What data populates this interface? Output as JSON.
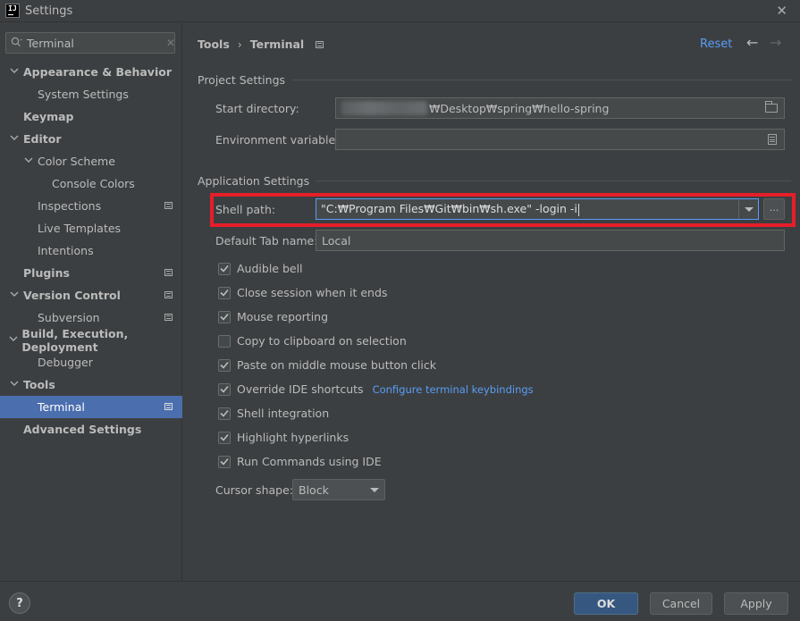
{
  "window": {
    "title": "Settings",
    "app_icon_text": "IJ"
  },
  "sidebar": {
    "search": {
      "value": "Terminal",
      "placeholder": ""
    },
    "items": [
      {
        "label": "Appearance & Behavior",
        "level": 0,
        "bold": true,
        "arrow": "expanded"
      },
      {
        "label": "System Settings",
        "level": 1
      },
      {
        "label": "Keymap",
        "level": 0,
        "bold": true
      },
      {
        "label": "Editor",
        "level": 0,
        "bold": true,
        "arrow": "expanded"
      },
      {
        "label": "Color Scheme",
        "level": 1,
        "arrow": "expanded"
      },
      {
        "label": "Console Colors",
        "level": 2
      },
      {
        "label": "Inspections",
        "level": 1,
        "project_icon": true
      },
      {
        "label": "Live Templates",
        "level": 1
      },
      {
        "label": "Intentions",
        "level": 1
      },
      {
        "label": "Plugins",
        "level": 0,
        "bold": true,
        "project_icon": true
      },
      {
        "label": "Version Control",
        "level": 0,
        "bold": true,
        "arrow": "expanded",
        "project_icon": true
      },
      {
        "label": "Subversion",
        "level": 1,
        "project_icon": true
      },
      {
        "label": "Build, Execution, Deployment",
        "level": 0,
        "bold": true,
        "arrow": "expanded"
      },
      {
        "label": "Debugger",
        "level": 1
      },
      {
        "label": "Tools",
        "level": 0,
        "bold": true,
        "arrow": "expanded"
      },
      {
        "label": "Terminal",
        "level": 1,
        "selected": true,
        "project_icon": true
      },
      {
        "label": "Advanced Settings",
        "level": 0,
        "bold": true
      }
    ]
  },
  "header": {
    "breadcrumb": [
      "Tools",
      "Terminal"
    ],
    "breadcrumb_sep": "›",
    "reset_label": "Reset",
    "back_icon": "←",
    "forward_icon": "→"
  },
  "project_settings": {
    "title": "Project Settings",
    "start_directory": {
      "label": "Start directory:",
      "value": "₩Desktop₩spring₩hello-spring"
    },
    "env_vars": {
      "label": "Environment variables:",
      "value": ""
    }
  },
  "application_settings": {
    "title": "Application Settings",
    "shell_path": {
      "label": "Shell path:",
      "value": "\"C:₩Program Files₩Git₩bin₩sh.exe\" -login -i",
      "browse_label": "..."
    },
    "default_tab": {
      "label": "Default Tab name:",
      "value": "Local"
    },
    "checkboxes": [
      {
        "label": "Audible bell",
        "checked": true
      },
      {
        "label": "Close session when it ends",
        "checked": true
      },
      {
        "label": "Mouse reporting",
        "checked": true
      },
      {
        "label": "Copy to clipboard on selection",
        "checked": false
      },
      {
        "label": "Paste on middle mouse button click",
        "checked": true
      },
      {
        "label": "Override IDE shortcuts",
        "checked": true,
        "link": "Configure terminal keybindings"
      },
      {
        "label": "Shell integration",
        "checked": true
      },
      {
        "label": "Highlight hyperlinks",
        "checked": true
      },
      {
        "label": "Run Commands using IDE",
        "checked": true
      }
    ],
    "cursor_shape": {
      "label": "Cursor shape:",
      "value": "Block"
    }
  },
  "footer": {
    "help_label": "?",
    "ok_label": "OK",
    "cancel_label": "Cancel",
    "apply_label": "Apply"
  },
  "colors": {
    "background": "#3c3f41",
    "selection": "#4b6eaf",
    "link": "#589df6",
    "highlight_border": "#e61e2a",
    "primary_button": "#365880"
  }
}
